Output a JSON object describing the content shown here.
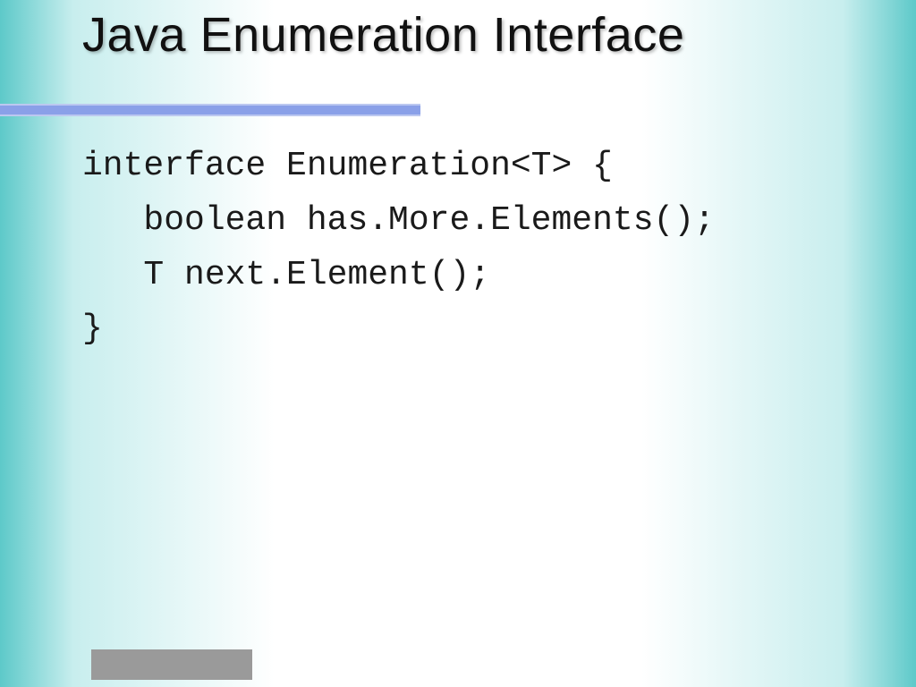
{
  "title": "Java Enumeration Interface",
  "code": {
    "line1": "interface Enumeration<T> {",
    "line2": "   boolean has.More.Elements();",
    "line3": "   T next.Element();",
    "line4": "}"
  }
}
